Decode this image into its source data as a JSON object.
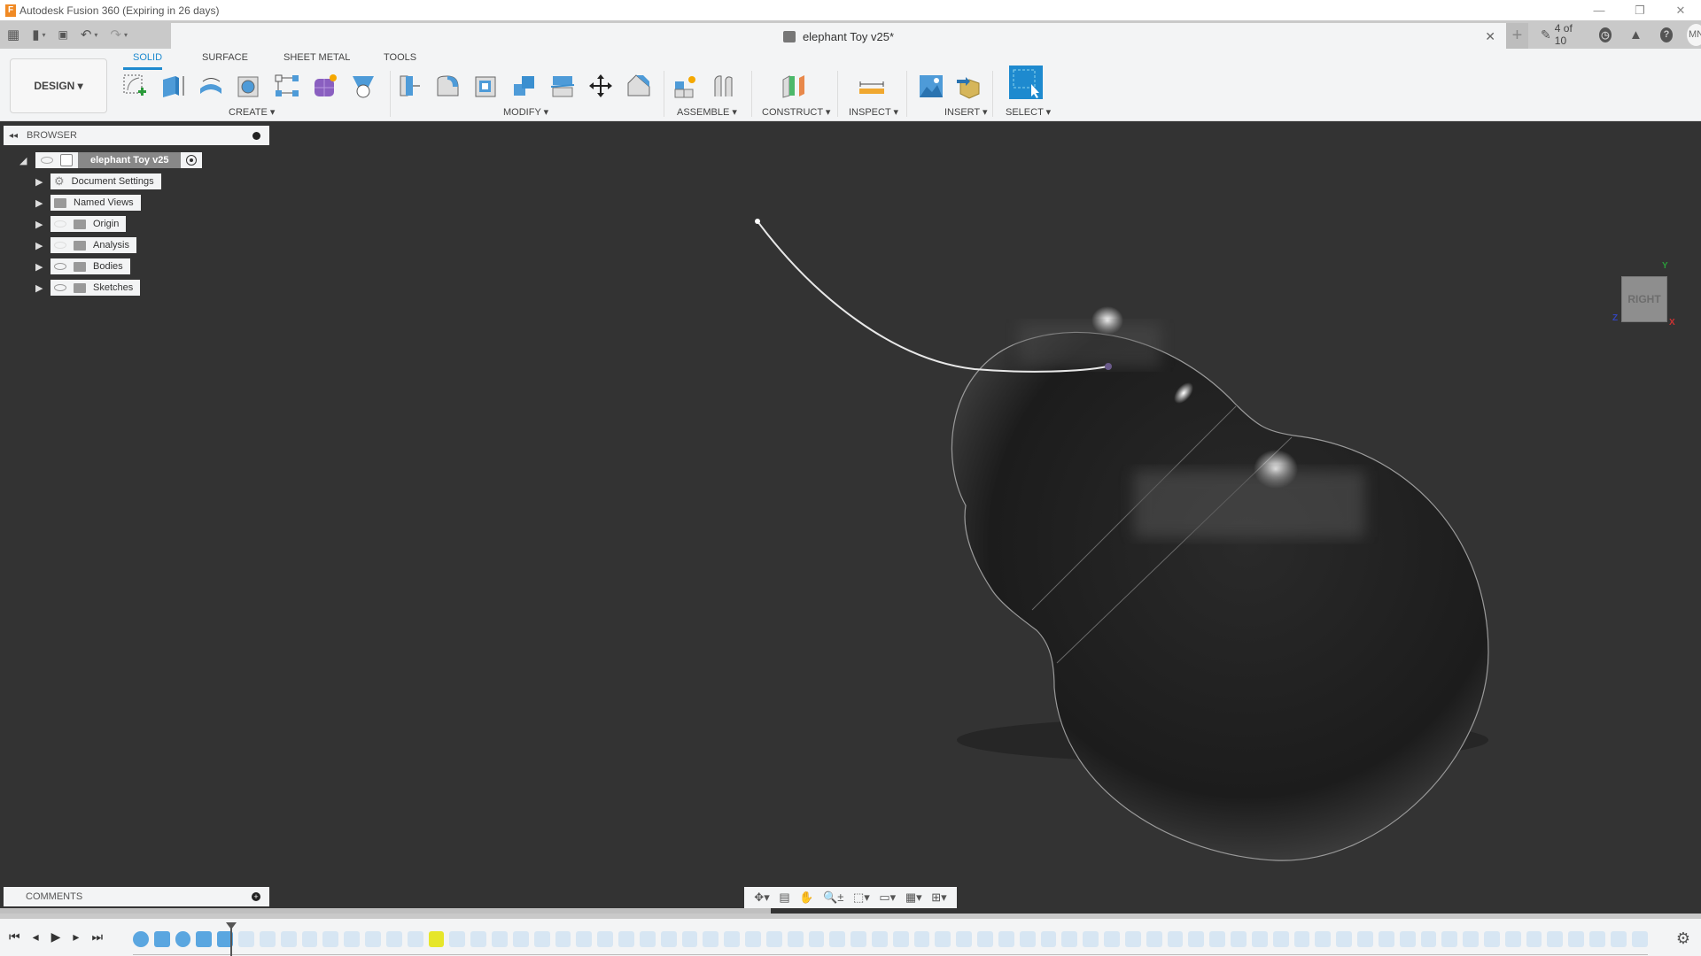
{
  "app": {
    "title": "Autodesk Fusion 360 (Expiring in 26 days)",
    "logo_letter": "F",
    "window_controls": {
      "minimize": "—",
      "restore": "❐",
      "close": "✕"
    }
  },
  "quick_access": {
    "grid_icon": "▦",
    "file_icon": "▮",
    "save_icon": "💾",
    "undo_icon": "↶",
    "redo_icon": "↷",
    "dropdown_glyph": "▾"
  },
  "document_tab": {
    "title": "elephant Toy v25*",
    "close_glyph": "✕"
  },
  "header_right": {
    "new_tab_glyph": "+",
    "jobs_icon": "✎",
    "jobs_status": "4 of 10",
    "clock_glyph": "◷",
    "bell_glyph": "🔔",
    "help_glyph": "?",
    "user_initials": "MN"
  },
  "ribbon": {
    "workspace": "DESIGN ▾",
    "tabs": [
      {
        "label": "SOLID",
        "active": true
      },
      {
        "label": "SURFACE",
        "active": false
      },
      {
        "label": "SHEET METAL",
        "active": false
      },
      {
        "label": "TOOLS",
        "active": false
      }
    ],
    "groups": {
      "create": "CREATE ▾",
      "modify": "MODIFY ▾",
      "assemble": "ASSEMBLE ▾",
      "construct": "CONSTRUCT ▾",
      "inspect": "INSPECT ▾",
      "insert": "INSERT ▾",
      "select": "SELECT ▾"
    },
    "tools": {
      "create": [
        "create-sketch",
        "extrude",
        "revolve",
        "hole",
        "pattern",
        "create-form",
        "create-base-feature"
      ],
      "modify": [
        "press-pull",
        "fillet",
        "shell",
        "combine",
        "split-body",
        "move-copy",
        "chamfer"
      ],
      "assemble": [
        "new-component",
        "joint"
      ],
      "construct": [
        "offset-plane"
      ],
      "inspect": [
        "measure"
      ],
      "insert": [
        "insert-canvas",
        "insert-mesh"
      ],
      "select": [
        "window-select"
      ]
    },
    "accent": "#1e8acf"
  },
  "browser": {
    "header": "BROWSER",
    "collapse_glyph": "◂◂",
    "root": {
      "label": "elephant Toy v25"
    },
    "items": [
      {
        "label": "Document Settings",
        "icon": "gear",
        "eye": "none"
      },
      {
        "label": "Named Views",
        "icon": "folder",
        "eye": "none"
      },
      {
        "label": "Origin",
        "icon": "folder",
        "eye": "hidden"
      },
      {
        "label": "Analysis",
        "icon": "folder",
        "eye": "hidden"
      },
      {
        "label": "Bodies",
        "icon": "folder",
        "eye": "visible"
      },
      {
        "label": "Sketches",
        "icon": "folder",
        "eye": "visible"
      }
    ]
  },
  "viewcube": {
    "face": "RIGHT",
    "axes": {
      "x": "X",
      "y": "Y",
      "z": "Z"
    }
  },
  "comments": {
    "header": "COMMENTS",
    "add_glyph": "+"
  },
  "nav_bar": {
    "orbit": "✥▾",
    "look_at": "▤",
    "pan": "✋",
    "zoom": "🔍±",
    "fit": "⬚▾",
    "display": "▭▾",
    "grid": "▦▾",
    "viewports": "⊞▾"
  },
  "timeline": {
    "controls": [
      "⏮",
      "◂",
      "▶",
      "▸",
      "⏭"
    ],
    "settings_glyph": "⚙",
    "feature_count": 72,
    "active_through": 5,
    "highlight_index": 14
  }
}
